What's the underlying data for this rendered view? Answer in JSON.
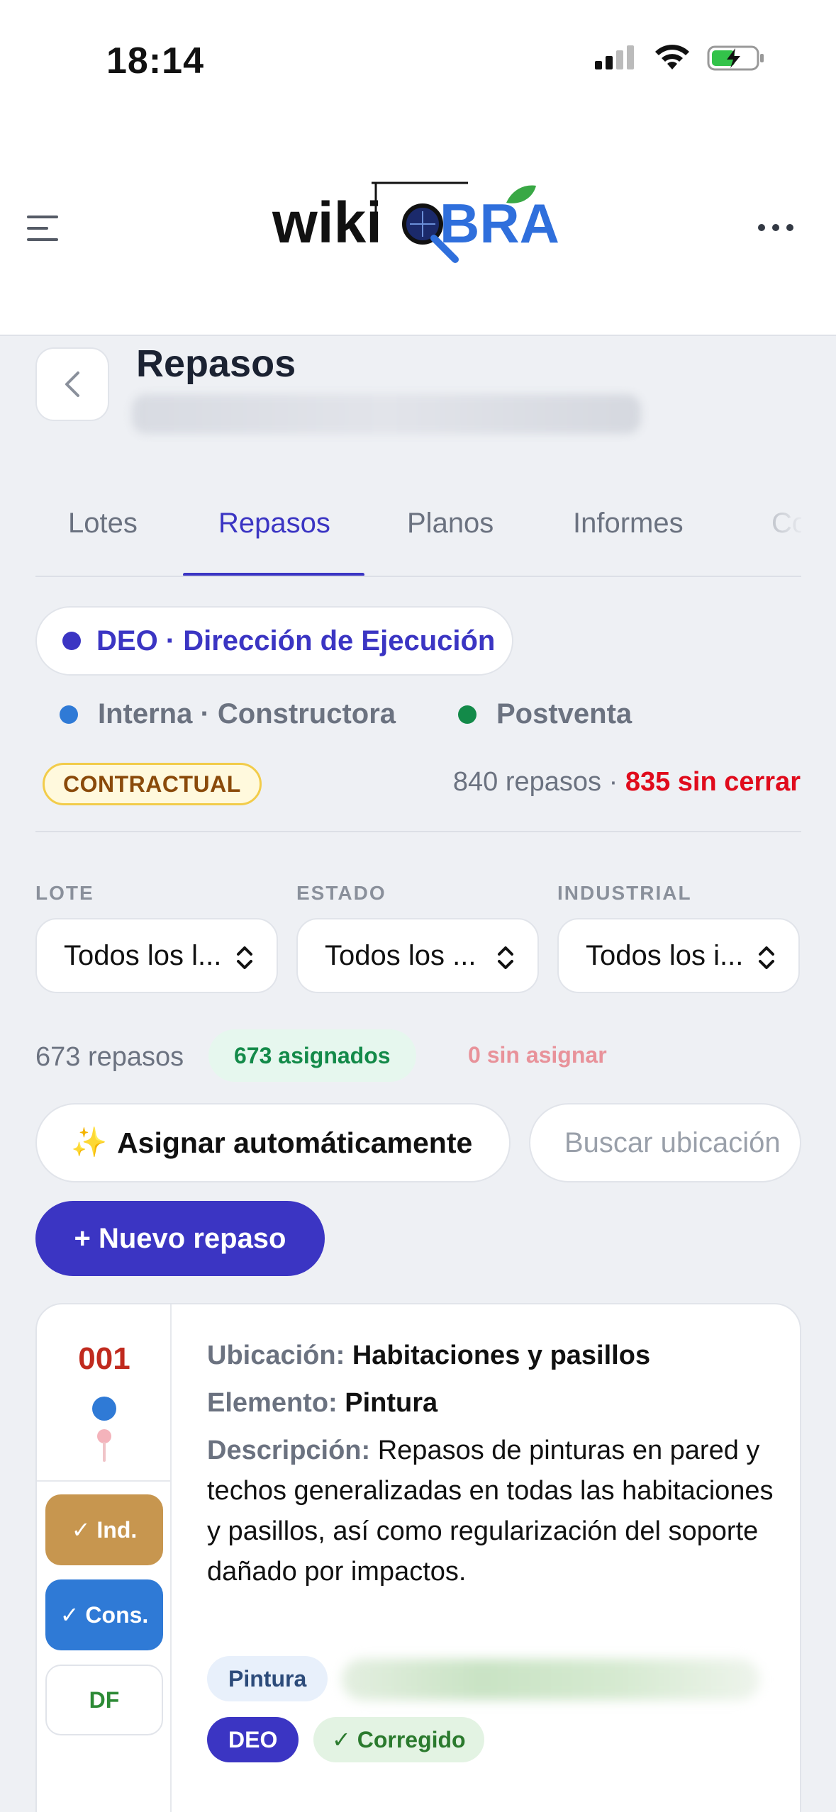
{
  "status_bar": {
    "time": "18:14"
  },
  "app_bar": {
    "logo_text_left": "wiki",
    "logo_text_right": "BRA"
  },
  "page": {
    "title": "Repasos"
  },
  "tabs": [
    {
      "label": "Lotes",
      "active": false
    },
    {
      "label": "Repasos",
      "active": true
    },
    {
      "label": "Planos",
      "active": false
    },
    {
      "label": "Informes",
      "active": false
    },
    {
      "label": "Co",
      "active": false
    }
  ],
  "type_filters": {
    "selected": {
      "label": "DEO · Dirección de Ejecución",
      "color": "#3b35c3"
    },
    "others": [
      {
        "label": "Interna · Constructora",
        "color": "#2f7ad6"
      },
      {
        "label": "Postventa",
        "color": "#138a49"
      }
    ]
  },
  "summary": {
    "badge": "CONTRACTUAL",
    "total": "840 repasos",
    "separator": "·",
    "open": "835 sin cerrar"
  },
  "filters": [
    {
      "label": "LOTE",
      "value": "Todos los l..."
    },
    {
      "label": "ESTADO",
      "value": "Todos los ..."
    },
    {
      "label": "INDUSTRIAL",
      "value": "Todos los i..."
    }
  ],
  "assignment": {
    "total": "673 repasos",
    "assigned": "673 asignados",
    "unassigned": "0 sin asignar"
  },
  "actions": {
    "auto_assign_icon": "✨",
    "auto_assign": "Asignar automáticamente",
    "search_placeholder": "Buscar ubicación",
    "new_button": "+ Nuevo repaso"
  },
  "colors": {
    "accent": "#3b35c3",
    "danger": "#e00b1c",
    "success": "#138a49"
  },
  "cards": [
    {
      "number": "001",
      "location_label": "Ubicación:",
      "location": "Habitaciones y pasillos",
      "element_label": "Elemento:",
      "element": "Pintura",
      "description_label": "Descripción:",
      "description": "Repasos de pinturas en pared y techos generalizadas en todas las habitaciones y pasillos, así como regularización del soporte dañado por impactos.",
      "checks": [
        "✓ Ind.",
        "✓ Cons.",
        "DF"
      ],
      "tags": [
        "Pintura"
      ],
      "origin_badge": "DEO",
      "state_badge": "✓ Corregido"
    }
  ]
}
